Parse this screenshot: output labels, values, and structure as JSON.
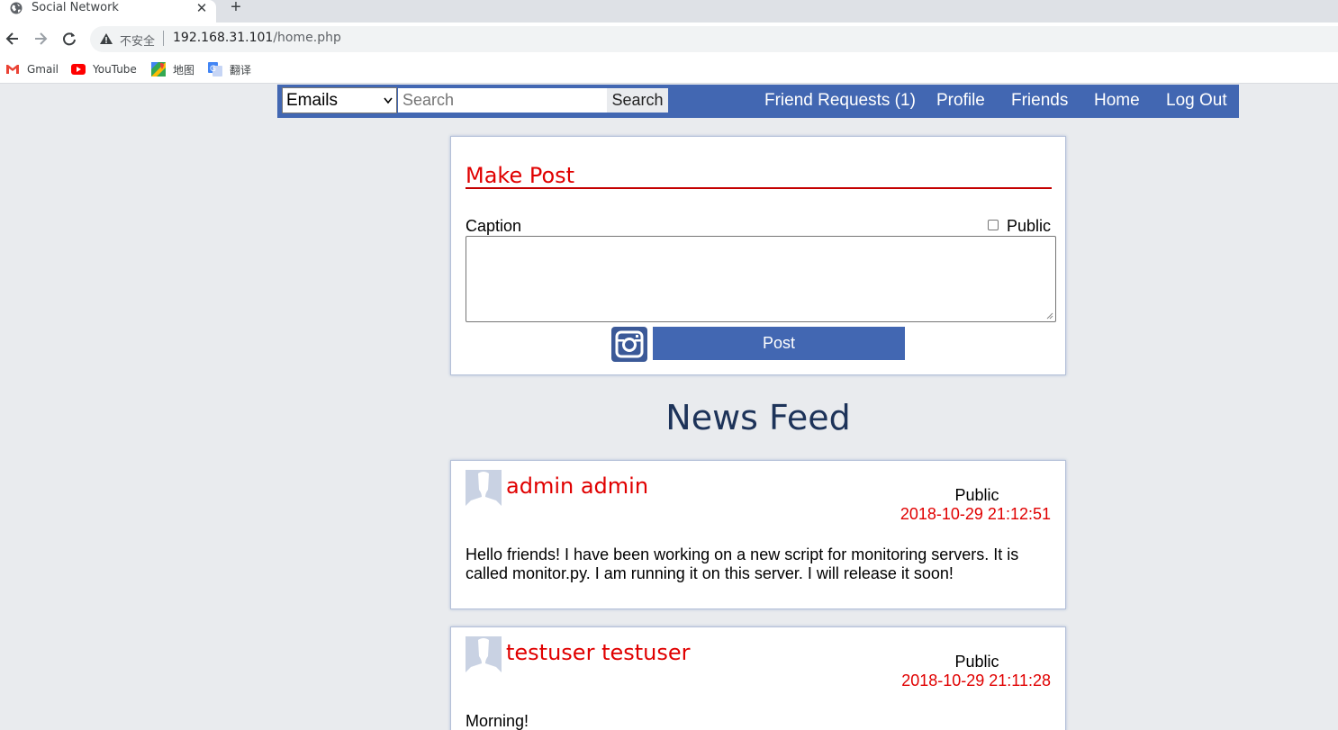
{
  "browser": {
    "tab_title": "Social Network",
    "tab_close": "✕",
    "new_tab": "+",
    "insecure_label": "不安全",
    "url_host": "192.168.31.101",
    "url_path": "/home.php",
    "bookmarks": [
      {
        "label": "Gmail",
        "icon": "gmail-icon"
      },
      {
        "label": "YouTube",
        "icon": "youtube-icon"
      },
      {
        "label": "地图",
        "icon": "maps-icon"
      },
      {
        "label": "翻译",
        "icon": "translate-icon"
      }
    ]
  },
  "nav": {
    "search_type": "Emails",
    "search_placeholder": "Search",
    "search_button": "Search",
    "links": {
      "friend_requests": "Friend Requests (1)",
      "profile": "Profile",
      "friends": "Friends",
      "home": "Home",
      "logout": "Log Out"
    },
    "color": "#4267b2"
  },
  "make_post": {
    "title": "Make Post",
    "caption_label": "Caption",
    "public_label": "Public",
    "public_checked": false,
    "post_button": "Post",
    "photo_icon": "instagram-camera-icon"
  },
  "feed": {
    "title": "News Feed",
    "posts": [
      {
        "author": "admin admin",
        "visibility": "Public",
        "timestamp": "2018-10-29 21:12:51",
        "body": "Hello friends! I have been working on a new script for monitoring servers. It is called monitor.py. I am running it on this server. I will release it soon!"
      },
      {
        "author": "testuser testuser",
        "visibility": "Public",
        "timestamp": "2018-10-29 21:11:28",
        "body": "Morning!"
      }
    ]
  },
  "colors": {
    "accent_red": "#e00000",
    "brand_blue": "#4267b2",
    "background": "#e9ebee"
  }
}
